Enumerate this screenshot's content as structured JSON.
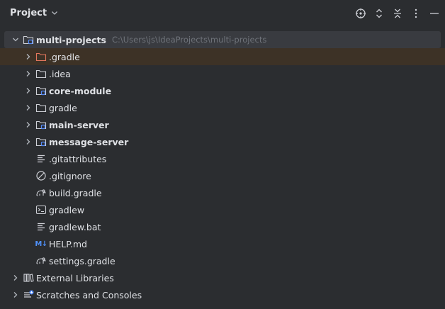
{
  "header": {
    "title": "Project"
  },
  "toolbar": {
    "locate_icon": "crosshair-icon",
    "expand_icon": "expand-all-icon",
    "collapse_icon": "collapse-all-icon",
    "options_icon": "more-vertical-icon",
    "hide_icon": "minimize-icon"
  },
  "tree": {
    "root": {
      "label": "multi-projects",
      "path": "C:\\Users\\js\\IdeaProjects\\multi-projects"
    },
    "items": [
      {
        "label": ".gradle"
      },
      {
        "label": ".idea"
      },
      {
        "label": "core-module"
      },
      {
        "label": "gradle"
      },
      {
        "label": "main-server"
      },
      {
        "label": "message-server"
      },
      {
        "label": ".gitattributes"
      },
      {
        "label": ".gitignore"
      },
      {
        "label": "build.gradle"
      },
      {
        "label": "gradlew"
      },
      {
        "label": "gradlew.bat"
      },
      {
        "label": "HELP.md",
        "icon_text": "M↓"
      },
      {
        "label": "settings.gradle"
      }
    ],
    "external_libraries": "External Libraries",
    "scratches": "Scratches and Consoles"
  }
}
